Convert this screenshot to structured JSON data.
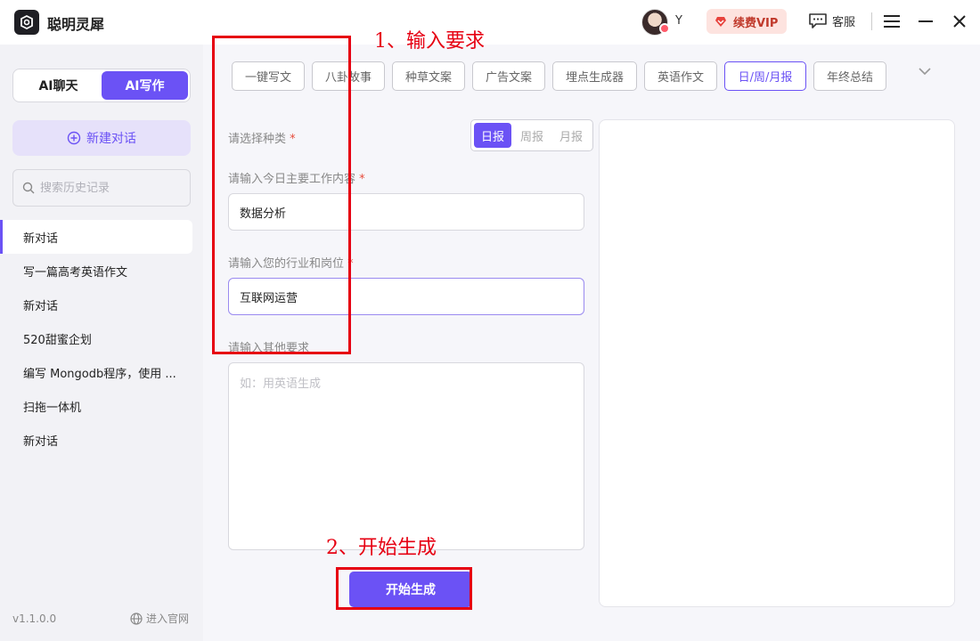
{
  "app": {
    "title": "聪明灵犀",
    "user_name": "Y",
    "vip_label": "续费VIP",
    "service_label": "客服"
  },
  "sidebar": {
    "modes": [
      {
        "label": "AI聊天",
        "active": false
      },
      {
        "label": "AI写作",
        "active": true
      }
    ],
    "new_chat_label": "新建对话",
    "search_placeholder": "搜索历史记录",
    "history": [
      {
        "label": "新对话",
        "active": true
      },
      {
        "label": "写一篇高考英语作文",
        "active": false
      },
      {
        "label": "新对话",
        "active": false
      },
      {
        "label": "520甜蜜企划",
        "active": false
      },
      {
        "label": "编写 Mongodb程序，使用 ...",
        "active": false
      },
      {
        "label": "扫拖一体机",
        "active": false
      },
      {
        "label": "新对话",
        "active": false
      }
    ],
    "version": "v1.1.0.0",
    "official_site_label": "进入官网"
  },
  "main": {
    "tabs": [
      {
        "label": "一键写文",
        "active": false
      },
      {
        "label": "八卦故事",
        "active": false
      },
      {
        "label": "种草文案",
        "active": false
      },
      {
        "label": "广告文案",
        "active": false
      },
      {
        "label": "埋点生成器",
        "active": false
      },
      {
        "label": "英语作文",
        "active": false
      },
      {
        "label": "日/周/月报",
        "active": true
      },
      {
        "label": "年终总结",
        "active": false
      }
    ],
    "form": {
      "type_label": "请选择种类",
      "type_options": [
        {
          "label": "日报",
          "active": true
        },
        {
          "label": "周报",
          "active": false
        },
        {
          "label": "月报",
          "active": false
        }
      ],
      "work_label": "请输入今日主要工作内容",
      "work_value": "数据分析",
      "industry_label": "请输入您的行业和岗位",
      "industry_value": "互联网运营",
      "other_label": "请输入其他要求",
      "other_placeholder": "如：用英语生成",
      "required_mark": "*",
      "generate_label": "开始生成"
    }
  },
  "annotations": {
    "step1": "1、输入要求",
    "step2": "2、开始生成",
    "color": "#e60012"
  },
  "colors": {
    "accent": "#6b52f5",
    "vip_bg": "#fde3df",
    "vip_text": "#c0392b"
  }
}
